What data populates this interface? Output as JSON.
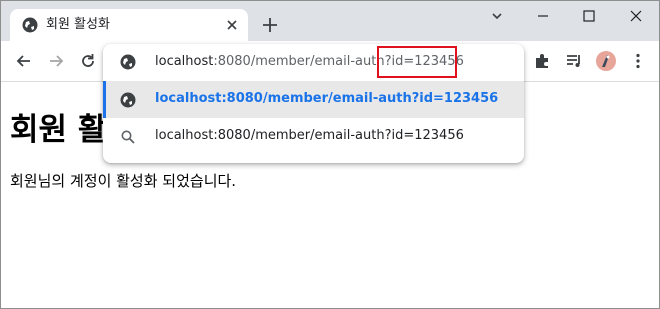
{
  "tab": {
    "title": "회원 활성화",
    "icon": "globe-icon"
  },
  "omnibox": {
    "host": "localhost",
    "path": ":8080/member/email-auth?id=123456",
    "suggestions": [
      {
        "icon": "globe-icon",
        "host_part": "localhost:8080/member/email-auth",
        "query_part": "?id=123456",
        "selected": true
      },
      {
        "icon": "search-icon",
        "text": "localhost:8080/member/email-auth?id=123456",
        "selected": false
      }
    ]
  },
  "page": {
    "heading": "회원 활",
    "message": "회원님의 계정이 활성화 되었습니다."
  },
  "colors": {
    "accent": "#1a73e8",
    "highlight": "#e0101c",
    "titlebar": "#dee1e6"
  }
}
